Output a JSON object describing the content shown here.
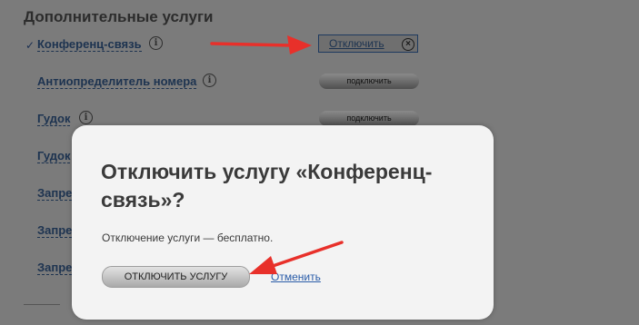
{
  "section": {
    "title": "Дополнительные услуги"
  },
  "services": [
    {
      "name": "Конференц-связь",
      "checked": true,
      "info": "i"
    },
    {
      "name": "Антиопределитель номера",
      "button": "подключить",
      "info": "i"
    },
    {
      "name": "Гудок",
      "button": "подключить",
      "info": "i"
    },
    {
      "name": "Гудок"
    },
    {
      "name": "Запре"
    },
    {
      "name": "Запре"
    },
    {
      "name": "Запре"
    }
  ],
  "active_service": {
    "disable_link": "Отключить",
    "close_glyph": "×",
    "check_glyph": "✓"
  },
  "modal": {
    "title": "Отключить услугу «Конференц-связь»?",
    "description": "Отключение услуги — бесплатно.",
    "confirm_button": "ОТКЛЮЧИТЬ УСЛУГУ",
    "cancel_link": "Отменить"
  },
  "colors": {
    "annotation_arrow": "#e8302a",
    "link": "#2a5ca8",
    "overlay": "#7b7b7b",
    "modal_bg": "#f3f3f3"
  }
}
